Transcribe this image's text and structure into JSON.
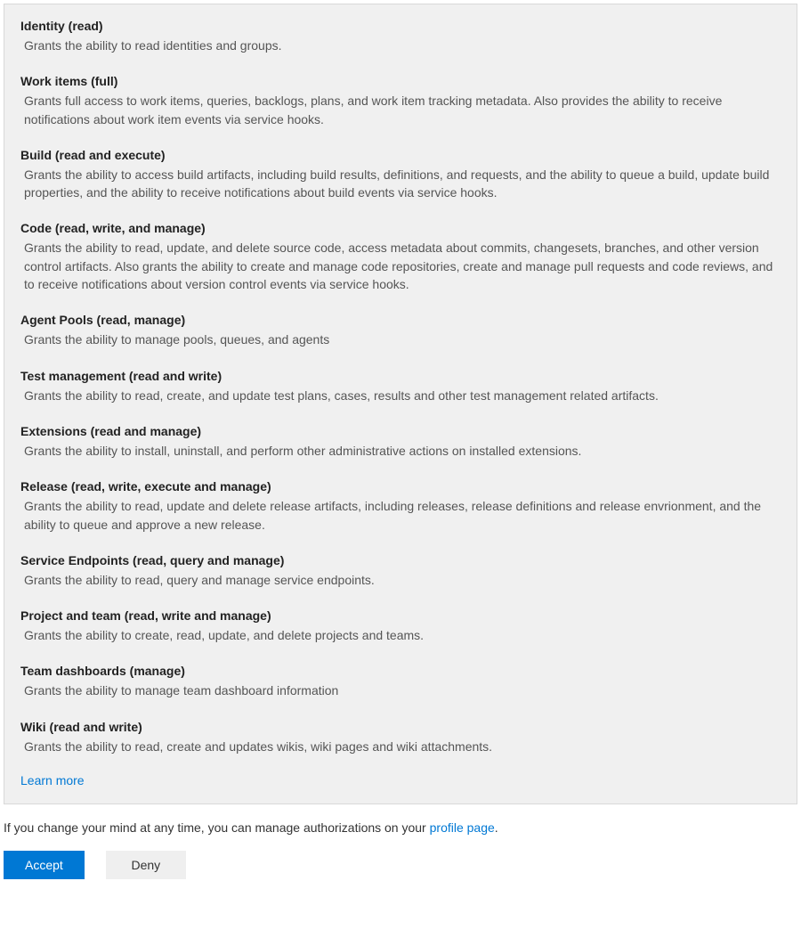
{
  "scopes": [
    {
      "title": "Identity (read)",
      "desc": "Grants the ability to read identities and groups."
    },
    {
      "title": "Work items (full)",
      "desc": "Grants full access to work items, queries, backlogs, plans, and work item tracking metadata. Also provides the ability to receive notifications about work item events via service hooks."
    },
    {
      "title": "Build (read and execute)",
      "desc": "Grants the ability to access build artifacts, including build results, definitions, and requests, and the ability to queue a build, update build properties, and the ability to receive notifications about build events via service hooks."
    },
    {
      "title": "Code (read, write, and manage)",
      "desc": "Grants the ability to read, update, and delete source code, access metadata about commits, changesets, branches, and other version control artifacts. Also grants the ability to create and manage code repositories, create and manage pull requests and code reviews, and to receive notifications about version control events via service hooks."
    },
    {
      "title": "Agent Pools (read, manage)",
      "desc": "Grants the ability to manage pools, queues, and agents"
    },
    {
      "title": "Test management (read and write)",
      "desc": "Grants the ability to read, create, and update test plans, cases, results and other test management related artifacts."
    },
    {
      "title": "Extensions (read and manage)",
      "desc": "Grants the ability to install, uninstall, and perform other administrative actions on installed extensions."
    },
    {
      "title": "Release (read, write, execute and manage)",
      "desc": "Grants the ability to read, update and delete release artifacts, including releases, release definitions and release envrionment, and the ability to queue and approve a new release."
    },
    {
      "title": "Service Endpoints (read, query and manage)",
      "desc": "Grants the ability to read, query and manage service endpoints."
    },
    {
      "title": "Project and team (read, write and manage)",
      "desc": "Grants the ability to create, read, update, and delete projects and teams."
    },
    {
      "title": "Team dashboards (manage)",
      "desc": "Grants the ability to manage team dashboard information"
    },
    {
      "title": "Wiki (read and write)",
      "desc": "Grants the ability to read, create and updates wikis, wiki pages and wiki attachments."
    }
  ],
  "learn_more": "Learn more",
  "footer": {
    "prefix": "If you change your mind at any time, you can manage authorizations on your ",
    "link": "profile page",
    "suffix": "."
  },
  "buttons": {
    "accept": "Accept",
    "deny": "Deny"
  }
}
